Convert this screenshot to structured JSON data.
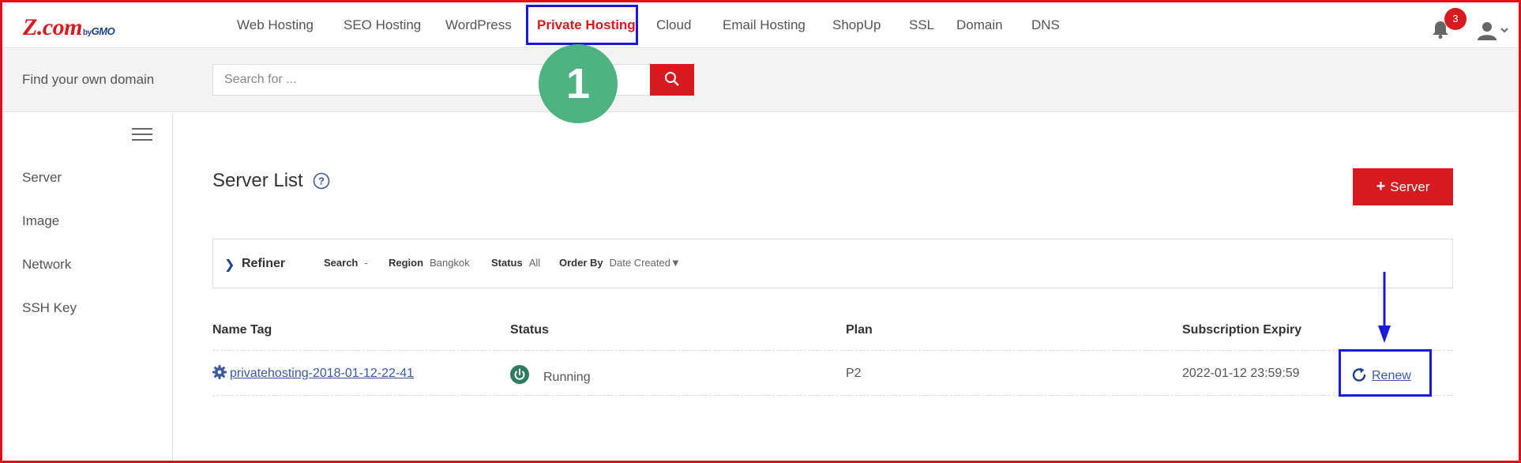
{
  "brand": {
    "logo": "Z.com",
    "by": "by",
    "gmo": "GMO",
    "color": "#d71920"
  },
  "nav": {
    "items": [
      {
        "label": "Web Hosting"
      },
      {
        "label": "SEO Hosting"
      },
      {
        "label": "WordPress"
      },
      {
        "label": "Private Hosting",
        "active": true
      },
      {
        "label": "Cloud"
      },
      {
        "label": "Email Hosting"
      },
      {
        "label": "ShopUp"
      },
      {
        "label": "SSL"
      },
      {
        "label": "Domain"
      },
      {
        "label": "DNS"
      }
    ],
    "notification_count": "3",
    "icons": [
      "bell-icon",
      "user-icon",
      "chevron-down-icon"
    ]
  },
  "domain_search": {
    "label": "Find your own domain",
    "placeholder": "Search for ...",
    "button_icon": "search-icon"
  },
  "annotation": {
    "step": "1",
    "step_color": "#4db380",
    "highlight_color": "#1a1ad9"
  },
  "sidebar": {
    "items": [
      {
        "label": "Server"
      },
      {
        "label": "Image"
      },
      {
        "label": "Network"
      },
      {
        "label": "SSH Key"
      }
    ]
  },
  "main": {
    "title": "Server List",
    "add_button": {
      "plus": "+",
      "label": "Server"
    },
    "refiner": {
      "title": "Refiner",
      "filters": [
        {
          "key": "Search",
          "value": "-"
        },
        {
          "key": "Region",
          "value": "Bangkok"
        },
        {
          "key": "Status",
          "value": "All"
        },
        {
          "key": "Order By",
          "value": "Date Created▼"
        }
      ]
    },
    "table": {
      "headers": [
        "Name Tag",
        "Status",
        "Plan",
        "Subscription Expiry"
      ],
      "rows": [
        {
          "name": " privatehosting-2018-01-12-22-41",
          "status": "Running",
          "status_color": "#2e7d62",
          "plan": "P2",
          "expiry": "2022-01-12 23:59:59",
          "action": "Renew"
        }
      ]
    }
  }
}
